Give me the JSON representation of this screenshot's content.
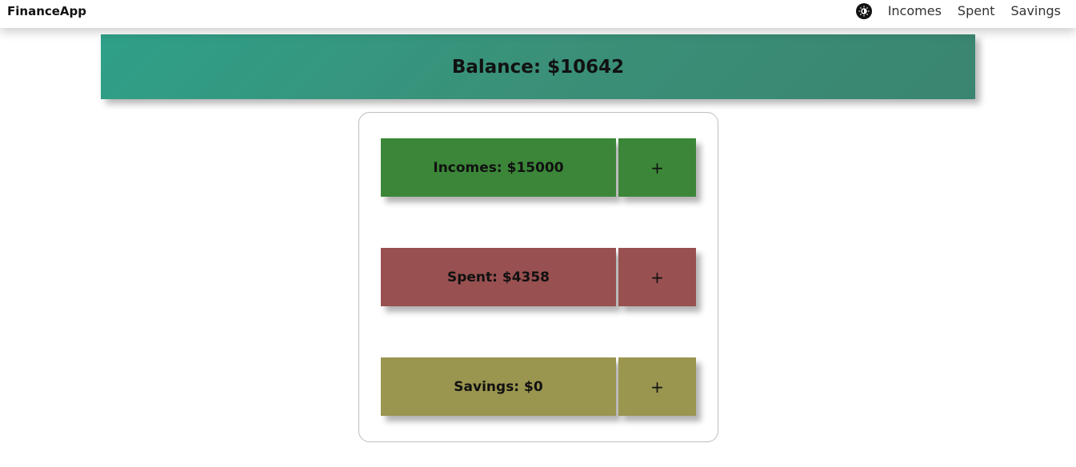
{
  "navbar": {
    "brand": "FinanceApp",
    "theme_icon": "theme-toggle-icon",
    "links": [
      {
        "label": "Incomes"
      },
      {
        "label": "Spent"
      },
      {
        "label": "Savings"
      }
    ]
  },
  "balance": {
    "text": "Balance: $10642",
    "gradient_start": "#2fa088",
    "gradient_end": "#3a8570"
  },
  "rows": [
    {
      "label": "Incomes: $15000",
      "add": "+",
      "color": "#3b8638"
    },
    {
      "label": "Spent: $4358",
      "add": "+",
      "color": "#985050"
    },
    {
      "label": "Savings: $0",
      "add": "+",
      "color": "#9a954f"
    }
  ]
}
